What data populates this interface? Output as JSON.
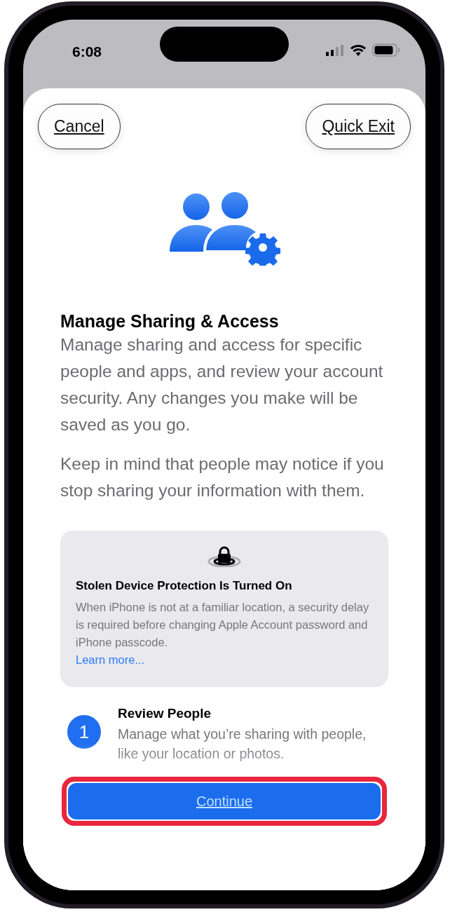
{
  "status_bar": {
    "time": "6:08"
  },
  "header": {
    "buttons": [
      "Cancel",
      "Quick Exit"
    ]
  },
  "title": "Manage Sharing & Access",
  "paragraphs": [
    "Manage sharing and access for specific people and apps, and review your account security. Any changes you make will be saved as you go.",
    "Keep in mind that people may notice if you stop sharing your information with them."
  ],
  "notice": {
    "title": "Stolen Device Protection Is Turned On",
    "text": "When iPhone is not at a familiar location, a security delay is required before changing Apple Account password and iPhone passcode.",
    "link": "Learn more..."
  },
  "steps": [
    {
      "number": "1",
      "title": "Review People",
      "text": "Manage what you’re sharing with people, like your location or photos."
    }
  ],
  "primary_button": "Continue"
}
